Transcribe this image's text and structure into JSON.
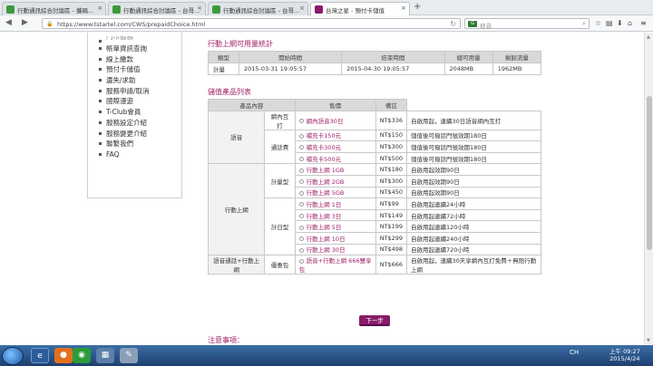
{
  "tabs": [
    {
      "title": "行動通訊綜合討論區 - 攜碼...",
      "fav_color": "#3a9a3a",
      "active": false
    },
    {
      "title": "行動通訊綜合討論區 - 台哥...",
      "fav_color": "#3a9a3a",
      "active": false
    },
    {
      "title": "行動通訊綜合討論區 - 台哥...",
      "fav_color": "#3a9a3a",
      "active": false
    },
    {
      "title": "台灣之星 - 預付卡儲值",
      "fav_color": "#8a1b6c",
      "active": true
    }
  ],
  "new_tab": "+",
  "address": {
    "url": "https://www.tstartel.com/CWS/prepaidChoice.html"
  },
  "search": {
    "engine_badge": "G",
    "placeholder": "搜尋"
  },
  "sidebar": {
    "items": [
      "門市服務",
      "帳單資訊查詢",
      "線上繳款",
      "預付卡儲值",
      "遺失/求助",
      "服務申請/取消",
      "國際漫遊",
      "T-Club會員",
      "服務設定介紹",
      "服務變更介紹",
      "聯繫我們",
      "FAQ"
    ]
  },
  "usage": {
    "heading": "行動上網可用量統計",
    "headers": [
      "類型",
      "開始時間",
      "結束時間",
      "總可用量",
      "剩餘流量"
    ],
    "row": [
      "計量",
      "2015-03-31 19:05:57",
      "2015-04-30 19:05:57",
      "2048MB",
      "1962MB"
    ]
  },
  "products": {
    "heading": "儲值產品列表",
    "headers": [
      "產品內容",
      "售價",
      "備註"
    ],
    "groups": [
      {
        "cat": "語音",
        "subs": [
          {
            "sub": "網內互打",
            "rows": [
              {
                "name": "網內語音30日",
                "price": "NT$336",
                "note": "自啟用起，連續30日語音網內互打"
              }
            ]
          },
          {
            "sub": "通話費",
            "rows": [
              {
                "name": "補充卡150元",
                "price": "NT$150",
                "note": "儲值後可撥話門號效期180日"
              },
              {
                "name": "補充卡300元",
                "price": "NT$300",
                "note": "儲值後可撥話門號效期180日"
              },
              {
                "name": "補充卡500元",
                "price": "NT$500",
                "note": "儲值後可撥話門號效期180日"
              }
            ]
          }
        ]
      },
      {
        "cat": "行動上網",
        "subs": [
          {
            "sub": "計量型",
            "rows": [
              {
                "name": "行動上網 1GB",
                "price": "NT$180",
                "note": "自啟用起效期90日"
              },
              {
                "name": "行動上網 2GB",
                "price": "NT$300",
                "note": "自啟用起效期90日"
              },
              {
                "name": "行動上網 5GB",
                "price": "NT$450",
                "note": "自啟用起效期90日"
              }
            ]
          },
          {
            "sub": "計日型",
            "rows": [
              {
                "name": "行動上網 1日",
                "price": "NT$99",
                "note": "自啟用起連續24小時"
              },
              {
                "name": "行動上網 3日",
                "price": "NT$149",
                "note": "自啟用起連續72小時"
              },
              {
                "name": "行動上網 5日",
                "price": "NT$199",
                "note": "自啟用起連續120小時"
              },
              {
                "name": "行動上網 10日",
                "price": "NT$299",
                "note": "自啟用起連續240小時"
              },
              {
                "name": "行動上網 30日",
                "price": "NT$498",
                "note": "自啟用起連續720小時"
              }
            ]
          }
        ]
      },
      {
        "cat": "語音通話+行動上網",
        "subs": [
          {
            "sub": "優惠包",
            "rows": [
              {
                "name": "語音+行動上網 666雙享包",
                "price": "NT$666",
                "note": "自啟用起，連續30天享網內互打免費＋無限行動上網"
              }
            ]
          }
        ]
      }
    ]
  },
  "next_button": "下一步",
  "notice_heading": "注意事項：",
  "taskbar": {
    "time": "上午 09:27",
    "date": "2015/4/24",
    "tray_lang": "CH"
  }
}
